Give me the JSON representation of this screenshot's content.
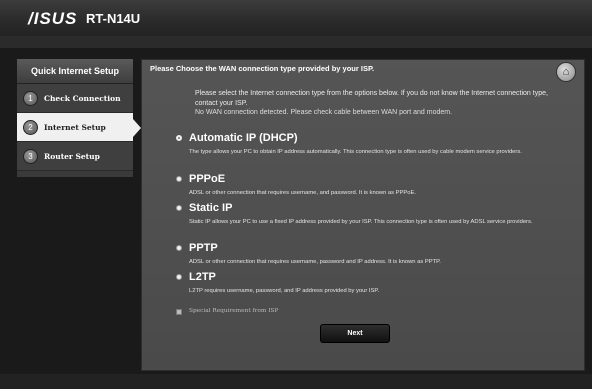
{
  "header": {
    "logo": "/ISUS",
    "model": "RT-N14U"
  },
  "sidebar": {
    "title": "Quick Internet Setup",
    "items": [
      {
        "num": "1",
        "label": "Check Connection"
      },
      {
        "num": "2",
        "label": "Internet Setup"
      },
      {
        "num": "3",
        "label": "Router Setup"
      }
    ]
  },
  "panel": {
    "title": "Please Choose the WAN connection type provided by your ISP.",
    "home_icon": "⌂",
    "intro": "Please select the Internet connection type from the options below. If you do not know the Internet connection type, contact your ISP.",
    "error": "No WAN connection detected. Please check cable between WAN port and modem.",
    "options": [
      {
        "name": "Automatic IP (DHCP)",
        "desc": "The type allows your PC to obtain IP address automatically. This connection type is often used by cable modem service providers."
      },
      {
        "name": "PPPoE",
        "desc": "ADSL or other connection that requires username, and password. It is known as PPPoE."
      },
      {
        "name": "Static IP",
        "desc": "Static IP allows your PC to use a fixed IP address provided by your ISP. This connection type is often used by ADSL service providers."
      },
      {
        "name": "PPTP",
        "desc": "ADSL or other connection that requires username, password and IP address. It is known as PPTP."
      },
      {
        "name": "L2TP",
        "desc": "L2TP requires username, password, and IP address provided by your ISP."
      }
    ],
    "selected_option": "Automatic IP (DHCP)",
    "special": "Special Requirement from ISP",
    "next": "Next"
  }
}
